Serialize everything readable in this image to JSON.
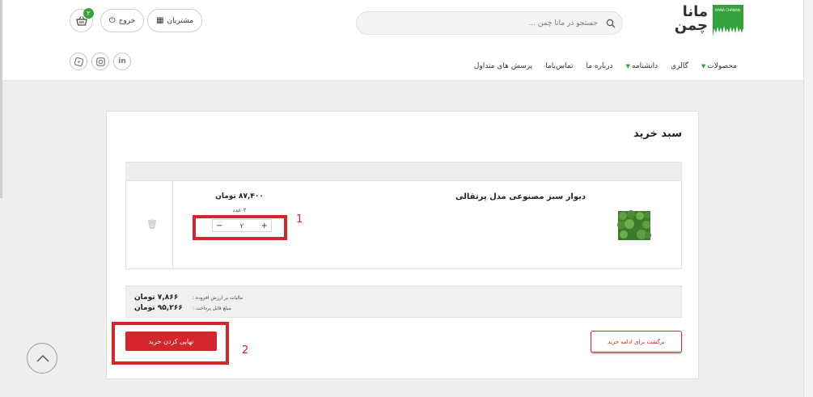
{
  "header": {
    "logo": {
      "line1": "مانا",
      "line2": "چمن",
      "badge_text": "MANA CHAMAN"
    },
    "search": {
      "placeholder": "جستجو در مانا چمن ..."
    },
    "buttons": {
      "customers": "مشتریان",
      "logout": "خروج"
    },
    "cart": {
      "badge_count": "۲"
    },
    "nav": [
      {
        "label": "محصولات",
        "dropdown": true
      },
      {
        "label": "گالری",
        "dropdown": false
      },
      {
        "label": "دانشنامه",
        "dropdown": true
      },
      {
        "label": "درباره ما",
        "dropdown": false
      },
      {
        "label": "تماس‌باما",
        "dropdown": false
      },
      {
        "label": "پرسش های متداول",
        "dropdown": false
      }
    ],
    "social": [
      "linkedin-icon",
      "instagram-icon",
      "aparat-icon"
    ]
  },
  "cart_page": {
    "title": "سبد خرید",
    "item": {
      "name": "دیوار سبز مصنوعی مدل پرتقالی",
      "price": "۸۷,۴۰۰ تومان",
      "qty_text": "۲ عدد",
      "qty_value": "۲",
      "minus": "−",
      "plus": "+"
    },
    "summary": {
      "tax_label": "مالیات بر ارزش افزوده :",
      "tax_amount": "۷,۸۶۶ تومان",
      "payable_label": "مبلغ قابل پرداخت :",
      "payable_amount": "۹۵,۲۶۶ تومان"
    },
    "finish_button": "نهایی کردن خرید",
    "back_button": "برگشت برای ادامه خرید"
  },
  "annotations": {
    "first": "1",
    "second": "2"
  },
  "colors": {
    "accent_red": "#d5262d",
    "brand_green": "#33a13c"
  }
}
